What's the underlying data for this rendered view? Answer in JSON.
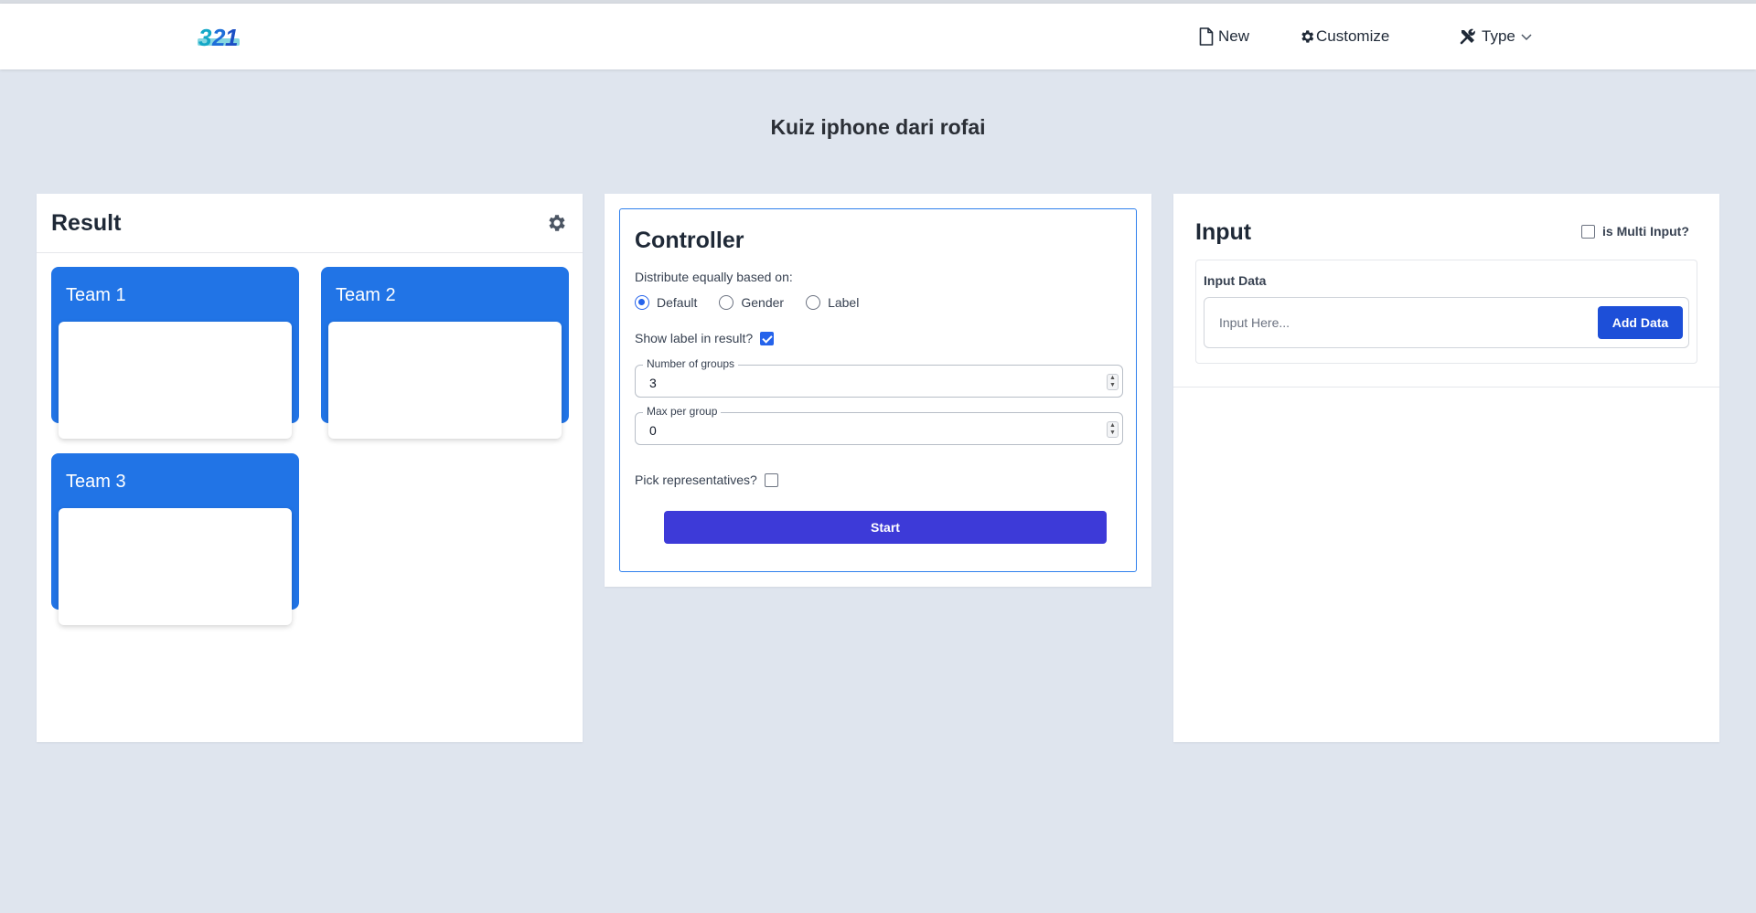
{
  "nav": {
    "new_label": "New",
    "customize_label": "Customize",
    "type_label": "Type"
  },
  "page": {
    "title": "Kuiz iphone dari rofai"
  },
  "result": {
    "title": "Result",
    "teams": [
      {
        "name": "Team 1"
      },
      {
        "name": "Team 2"
      },
      {
        "name": "Team 3"
      }
    ]
  },
  "controller": {
    "title": "Controller",
    "distribute_label": "Distribute equally based on:",
    "options": [
      "Default",
      "Gender",
      "Label"
    ],
    "selected_option": "Default",
    "show_label_text": "Show label in result?",
    "show_label_checked": true,
    "groups_label": "Number of groups",
    "groups_value": "3",
    "max_label": "Max per group",
    "max_value": "0",
    "pick_label": "Pick representatives?",
    "pick_checked": false,
    "start_label": "Start"
  },
  "input": {
    "title": "Input",
    "multi_label": "is Multi Input?",
    "multi_checked": false,
    "data_label": "Input Data",
    "placeholder": "Input Here...",
    "add_label": "Add Data"
  },
  "colors": {
    "background": "#dfe5ee",
    "team_blue": "#2174e6",
    "start_button": "#3d3ad8",
    "add_button": "#1d4fd8",
    "controller_border": "#2f80ed"
  }
}
